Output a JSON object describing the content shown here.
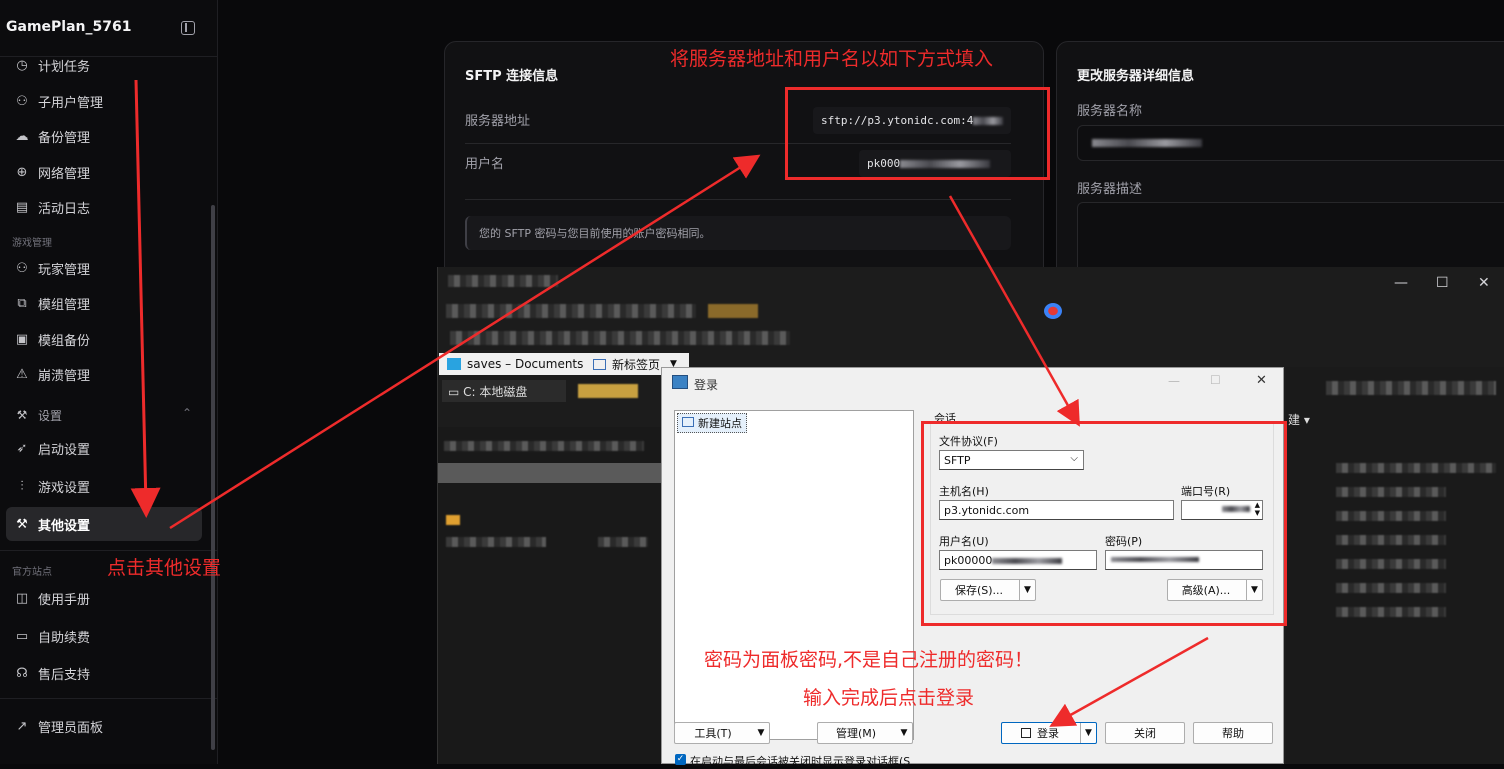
{
  "sidebar": {
    "brand": "GamePlan_5761",
    "items_top": [
      {
        "label": "计划任务",
        "icon": "clock-icon",
        "glyph": "◷"
      },
      {
        "label": "子用户管理",
        "icon": "users-icon",
        "glyph": "⚇"
      },
      {
        "label": "备份管理",
        "icon": "cloud-icon",
        "glyph": "☁"
      },
      {
        "label": "网络管理",
        "icon": "globe-icon",
        "glyph": "⊕"
      },
      {
        "label": "活动日志",
        "icon": "file-icon",
        "glyph": "▤"
      }
    ],
    "section_game": "游戏管理",
    "items_game": [
      {
        "label": "玩家管理",
        "icon": "users-icon",
        "glyph": "⚇"
      },
      {
        "label": "模组管理",
        "icon": "blocks-icon",
        "glyph": "⧉"
      },
      {
        "label": "模组备份",
        "icon": "save-icon",
        "glyph": "▣"
      },
      {
        "label": "崩溃管理",
        "icon": "warning-icon",
        "glyph": "⚠"
      }
    ],
    "settings_group": {
      "label": "设置",
      "icon": "wrench-icon",
      "glyph": "⚒",
      "chevron": "⌃"
    },
    "items_settings": [
      {
        "label": "启动设置",
        "icon": "rocket-icon",
        "glyph": "➶"
      },
      {
        "label": "游戏设置",
        "icon": "sliders-icon",
        "glyph": "⫶"
      },
      {
        "label": "其他设置",
        "icon": "wrench-icon",
        "glyph": "⚒"
      }
    ],
    "section_official": "官方站点",
    "items_official": [
      {
        "label": "使用手册",
        "icon": "book-icon",
        "glyph": "◫"
      },
      {
        "label": "自助续费",
        "icon": "credit-card-icon",
        "glyph": "▭"
      },
      {
        "label": "售后支持",
        "icon": "headset-icon",
        "glyph": "☊"
      }
    ],
    "admin": {
      "label": "管理员面板",
      "icon": "external-link-icon",
      "glyph": "↗"
    }
  },
  "sftp_card": {
    "title": "SFTP 连接信息",
    "server_label": "服务器地址",
    "server_value": "sftp://p3.ytonidc.com:4",
    "user_label": "用户名",
    "user_value": "pk000",
    "notice": "您的 SFTP 密码与您目前使用的账户密码相同。"
  },
  "details_card": {
    "title": "更改服务器详细信息",
    "name_label": "服务器名称",
    "desc_label": "服务器描述"
  },
  "annotations": {
    "top": "将服务器地址和用户名以如下方式填入",
    "left": "点击其他设置",
    "password_note": "密码为面板密码,不是自己注册的密码！",
    "login_note": "输入完成后点击登录",
    "color": "#ee2b2b"
  },
  "winscp": {
    "tab1": "saves – Documents",
    "tab2": "新标签页",
    "drive": "C: 本地磁盘",
    "right_new": "建 ▾"
  },
  "login_dialog": {
    "title": "登录",
    "site_item": "新建站点",
    "session_label": "会话",
    "protocol_label": "文件协议(F)",
    "protocol_value": "SFTP",
    "host_label": "主机名(H)",
    "host_value": "p3.ytonidc.com",
    "port_label": "端口号(R)",
    "user_label": "用户名(U)",
    "user_value": "pk00000",
    "password_label": "密码(P)",
    "save_btn": "保存(S)...",
    "advanced_btn": "高级(A)...",
    "tools_btn": "工具(T)",
    "manage_btn": "管理(M)",
    "login_btn": "登录",
    "close_btn": "关闭",
    "help_btn": "帮助",
    "checkbox_label": "在启动与最后会话被关闭时显示登录对话框(S"
  }
}
